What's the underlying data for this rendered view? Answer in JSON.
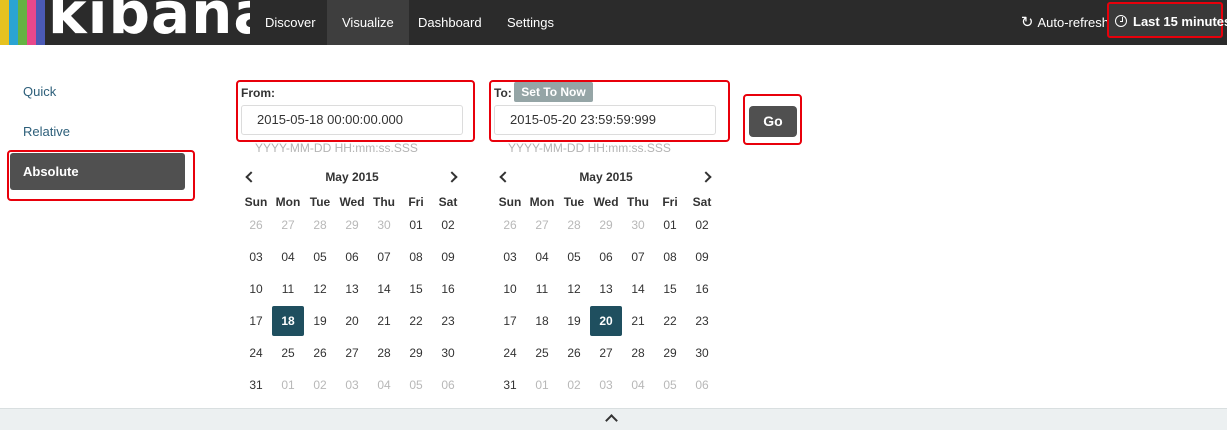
{
  "nav": {
    "brand": "kibana",
    "logo_colors": [
      "#e6c220",
      "#2ba4d3",
      "#65b343",
      "#e8488b",
      "#4b5ab6"
    ],
    "items": [
      {
        "label": "Discover"
      },
      {
        "label": "Visualize",
        "active": true
      },
      {
        "label": "Dashboard"
      },
      {
        "label": "Settings"
      }
    ],
    "auto_refresh": "Auto-refresh",
    "time_range": "Last 15 minutes"
  },
  "modes": {
    "quick": "Quick",
    "relative": "Relative",
    "absolute": "Absolute",
    "selected": "absolute"
  },
  "from": {
    "label": "From:",
    "value": "2015-05-18 00:00:00.000",
    "format": "YYYY-MM-DD HH:mm:ss.SSS"
  },
  "to": {
    "label": "To:",
    "set_to_now": "Set To Now",
    "value": "2015-05-20 23:59:59:999",
    "format": "YYYY-MM-DD HH:mm:ss.SSS"
  },
  "go": "Go",
  "calendars": [
    {
      "title": "May 2015",
      "weekdays": [
        "Sun",
        "Mon",
        "Tue",
        "Wed",
        "Thu",
        "Fri",
        "Sat"
      ],
      "selected": "18",
      "weeks": [
        [
          "26",
          "27",
          "28",
          "29",
          "30",
          "01",
          "02"
        ],
        [
          "03",
          "04",
          "05",
          "06",
          "07",
          "08",
          "09"
        ],
        [
          "10",
          "11",
          "12",
          "13",
          "14",
          "15",
          "16"
        ],
        [
          "17",
          "18",
          "19",
          "20",
          "21",
          "22",
          "23"
        ],
        [
          "24",
          "25",
          "26",
          "27",
          "28",
          "29",
          "30"
        ],
        [
          "31",
          "01",
          "02",
          "03",
          "04",
          "05",
          "06"
        ]
      ]
    },
    {
      "title": "May 2015",
      "weekdays": [
        "Sun",
        "Mon",
        "Tue",
        "Wed",
        "Thu",
        "Fri",
        "Sat"
      ],
      "selected": "20",
      "weeks": [
        [
          "26",
          "27",
          "28",
          "29",
          "30",
          "01",
          "02"
        ],
        [
          "03",
          "04",
          "05",
          "06",
          "07",
          "08",
          "09"
        ],
        [
          "10",
          "11",
          "12",
          "13",
          "14",
          "15",
          "16"
        ],
        [
          "17",
          "18",
          "19",
          "20",
          "21",
          "22",
          "23"
        ],
        [
          "24",
          "25",
          "26",
          "27",
          "28",
          "29",
          "30"
        ],
        [
          "31",
          "01",
          "02",
          "03",
          "04",
          "05",
          "06"
        ]
      ]
    }
  ],
  "colors": {
    "navbar": "#2b2b2b",
    "selected_day": "#1f4f5f",
    "highlight": "#e8000b"
  }
}
